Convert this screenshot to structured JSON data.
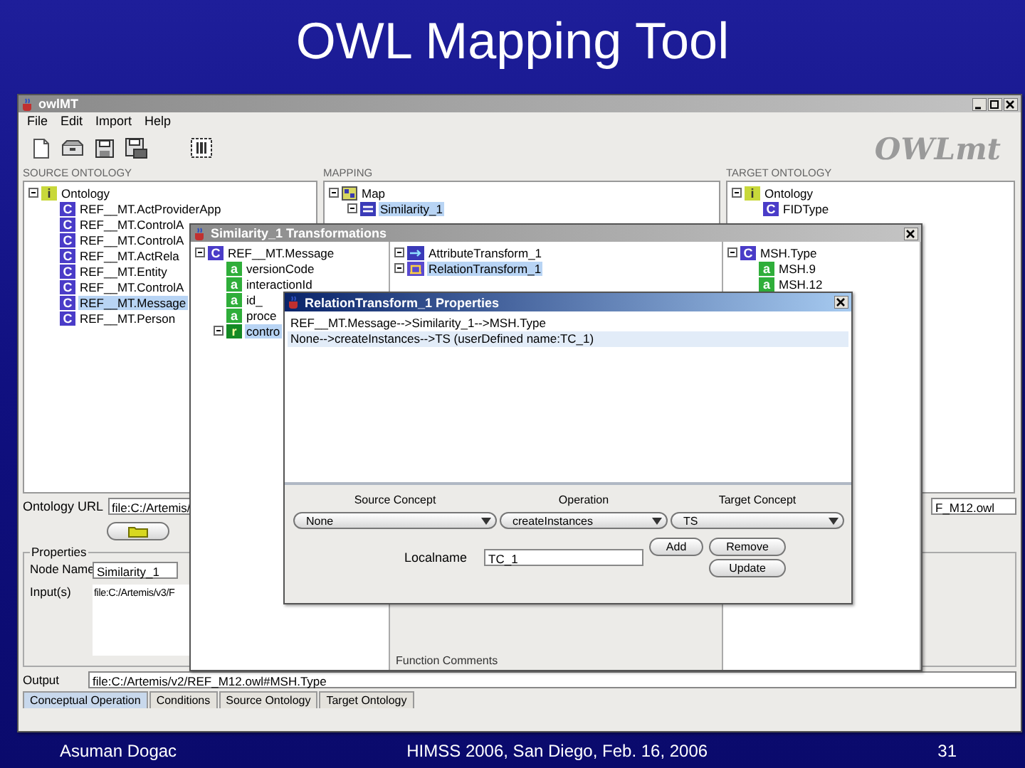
{
  "slide": {
    "title": "OWL Mapping Tool"
  },
  "main_window": {
    "title": "owlMT",
    "menu": [
      "File",
      "Edit",
      "Import",
      "Help"
    ],
    "logo": "OWLmt",
    "source_ontology": {
      "label": "SOURCE ONTOLOGY",
      "tree": [
        {
          "label": "Ontology",
          "badge": "i",
          "kind": "ontology",
          "expanded": true,
          "selected": false,
          "children": [
            {
              "label": "REF__MT.ActProviderApp",
              "badge": "C",
              "kind": "class",
              "selected": false
            },
            {
              "label": "REF__MT.ControlA",
              "badge": "C",
              "kind": "class",
              "selected": false
            },
            {
              "label": "REF__MT.ControlA",
              "badge": "C",
              "kind": "class",
              "selected": false
            },
            {
              "label": "REF__MT.ActRela",
              "badge": "C",
              "kind": "class",
              "selected": false
            },
            {
              "label": "REF__MT.Entity",
              "badge": "C",
              "kind": "class",
              "selected": false
            },
            {
              "label": "REF__MT.ControlA",
              "badge": "C",
              "kind": "class",
              "selected": false
            },
            {
              "label": "REF__MT.Message",
              "badge": "C",
              "kind": "class",
              "selected": true
            },
            {
              "label": "REF__MT.Person",
              "badge": "C",
              "kind": "class",
              "selected": false
            }
          ]
        }
      ]
    },
    "mapping": {
      "label": "MAPPING",
      "tree": [
        {
          "label": "Map",
          "kind": "map",
          "expanded": true,
          "selected": false,
          "children": [
            {
              "label": "Similarity_1",
              "kind": "similarity",
              "expanded": true,
              "selected": true
            }
          ]
        }
      ]
    },
    "target_ontology": {
      "label": "TARGET ONTOLOGY",
      "tree": [
        {
          "label": "Ontology",
          "badge": "i",
          "kind": "ontology",
          "expanded": true,
          "selected": false,
          "children": [
            {
              "label": "FIDType",
              "badge": "C",
              "kind": "class",
              "selected": false
            }
          ]
        }
      ]
    },
    "ontology_url": {
      "label": "Ontology URL",
      "value": "file:C:/Artemis/",
      "target_value": "F_M12.owl"
    },
    "properties": {
      "legend": "Properties",
      "node_name_label": "Node Name",
      "node_name": "Similarity_1",
      "inputs_label": "Input(s)",
      "inputs": "file:C:/Artemis/v3/F",
      "output_label": "Output",
      "output": "file:C:/Artemis/v2/REF_M12.owl#MSH.Type"
    },
    "tabs": [
      {
        "label": "Conceptual Operation",
        "selected": true
      },
      {
        "label": "Conditions",
        "selected": false
      },
      {
        "label": "Source Ontology",
        "selected": false
      },
      {
        "label": "Target Ontology",
        "selected": false
      }
    ]
  },
  "transformations_window": {
    "title": "Similarity_1 Transformations",
    "source_tree": [
      {
        "label": "REF__MT.Message",
        "badge": "C",
        "kind": "class",
        "expanded": true,
        "selected": false,
        "children": [
          {
            "label": "versionCode",
            "badge": "a",
            "kind": "attribute",
            "selected": false
          },
          {
            "label": "interactionId",
            "badge": "a",
            "kind": "attribute",
            "selected": false
          },
          {
            "label": "id_",
            "badge": "a",
            "kind": "attribute",
            "selected": false
          },
          {
            "label": "proce",
            "badge": "a",
            "kind": "attribute",
            "selected": false
          },
          {
            "label": "contro",
            "badge": "r",
            "kind": "relation",
            "expanded": true,
            "selected": true
          }
        ]
      }
    ],
    "transform_tree": [
      {
        "label": "AttributeTransform_1",
        "kind": "attribute-transform",
        "expanded": true,
        "selected": false
      },
      {
        "label": "RelationTransform_1",
        "kind": "relation-transform",
        "expanded": true,
        "selected": true
      }
    ],
    "target_tree": [
      {
        "label": "MSH.Type",
        "badge": "C",
        "kind": "class",
        "expanded": true,
        "selected": false,
        "children": [
          {
            "label": "MSH.9",
            "badge": "a",
            "kind": "attribute",
            "selected": false
          },
          {
            "label": "MSH.12",
            "badge": "a",
            "kind": "attribute",
            "selected": false
          }
        ]
      }
    ],
    "comments_label": "Function Comments"
  },
  "properties_dialog": {
    "title": "RelationTransform_1 Properties",
    "mappings": [
      {
        "text": "REF__MT.Message-->Similarity_1-->MSH.Type",
        "selected": false
      },
      {
        "text": "None-->createInstances-->TS (userDefined name:TC_1)",
        "selected": true
      }
    ],
    "source_concept": {
      "label": "Source Concept",
      "value": "None"
    },
    "operation": {
      "label": "Operation",
      "value": "createInstances"
    },
    "target_concept": {
      "label": "Target Concept",
      "value": "TS"
    },
    "localname": {
      "label": "Localname",
      "value": "TC_1"
    },
    "buttons": [
      "Add",
      "Remove",
      "Update"
    ]
  },
  "footer": {
    "author": "Asuman Dogac",
    "event": "HIMSS 2006, San Diego, Feb. 16, 2006",
    "page": "31"
  }
}
